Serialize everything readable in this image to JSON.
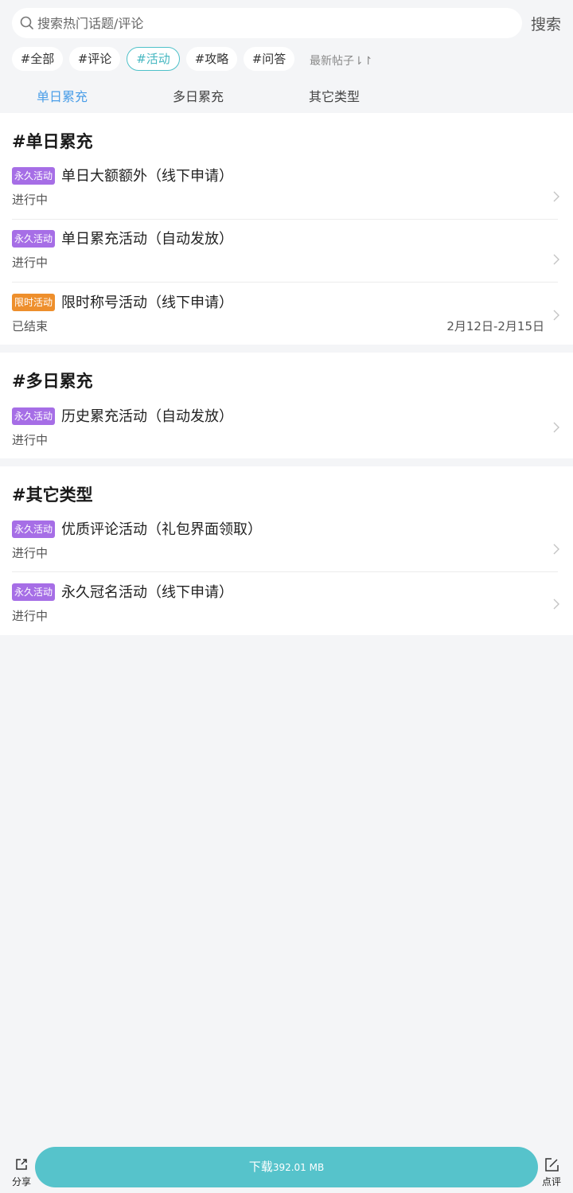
{
  "search": {
    "placeholder": "搜索热门话题/评论",
    "button_label": "搜索"
  },
  "chips": [
    {
      "label": "#全部",
      "active": false
    },
    {
      "label": "#评论",
      "active": false
    },
    {
      "label": "#活动",
      "active": true
    },
    {
      "label": "#攻略",
      "active": false
    },
    {
      "label": "#问答",
      "active": false
    }
  ],
  "sort_label": "最新帖子⇂↾",
  "tabs": [
    {
      "label": "单日累充",
      "active": true
    },
    {
      "label": "多日累充",
      "active": false
    },
    {
      "label": "其它类型",
      "active": false
    }
  ],
  "sections": [
    {
      "title": "#单日累充",
      "items": [
        {
          "badge": "永久活动",
          "badge_type": "perm",
          "title": "单日大额额外（线下申请）",
          "status": "进行中",
          "date": ""
        },
        {
          "badge": "永久活动",
          "badge_type": "perm",
          "title": "单日累充活动（自动发放）",
          "status": "进行中",
          "date": ""
        },
        {
          "badge": "限时活动",
          "badge_type": "limited",
          "title": "限时称号活动（线下申请）",
          "status": "已结束",
          "date": "2月12日-2月15日"
        }
      ]
    },
    {
      "title": "#多日累充",
      "items": [
        {
          "badge": "永久活动",
          "badge_type": "perm",
          "title": "历史累充活动（自动发放）",
          "status": "进行中",
          "date": ""
        }
      ]
    },
    {
      "title": "#其它类型",
      "items": [
        {
          "badge": "永久活动",
          "badge_type": "perm",
          "title": "优质评论活动（礼包界面领取）",
          "status": "进行中",
          "date": ""
        },
        {
          "badge": "永久活动",
          "badge_type": "perm",
          "title": "永久冠名活动（线下申请）",
          "status": "进行中",
          "date": ""
        }
      ]
    }
  ],
  "bottom": {
    "share_label": "分享",
    "download_label": "下载",
    "download_size": "392.01 MB",
    "review_label": "点评"
  },
  "colors": {
    "accent": "#4ec1c9",
    "tab_active": "#4a9ee8",
    "badge_perm": "#a66ee6",
    "badge_limited": "#ee8f2c",
    "download_bg": "#56c3cb"
  }
}
